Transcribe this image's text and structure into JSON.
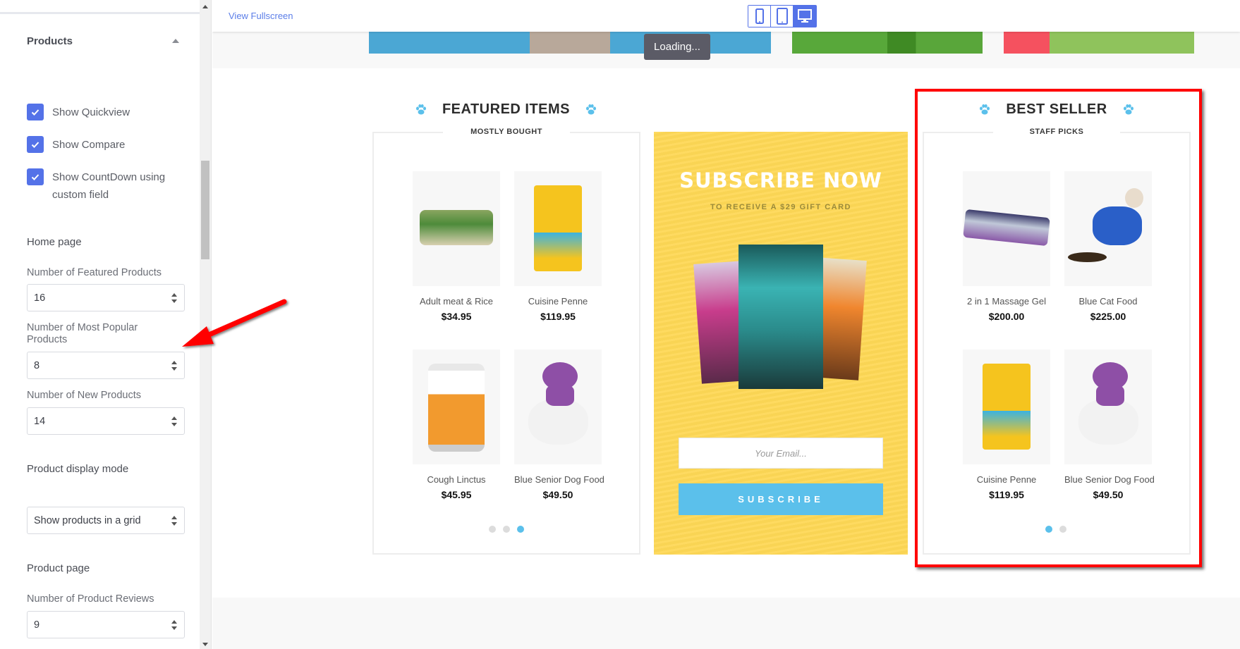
{
  "sidebar": {
    "section_title": "Products",
    "checkboxes": [
      {
        "label": "Show Quickview",
        "checked": true
      },
      {
        "label": "Show Compare",
        "checked": true
      },
      {
        "label": "Show CountDown using custom field",
        "checked": true
      }
    ],
    "home_heading": "Home page",
    "fields": {
      "featured": {
        "label": "Number of Featured Products",
        "value": "16"
      },
      "popular": {
        "label": "Number of Most Popular Products",
        "value": "8"
      },
      "new": {
        "label": "Number of New Products",
        "value": "14"
      }
    },
    "display_mode": {
      "label": "Product display mode",
      "value": "Show products in a grid"
    },
    "product_page_heading": "Product page",
    "reviews": {
      "label": "Number of Product Reviews",
      "value": "9"
    }
  },
  "preview": {
    "view_fullscreen": "View Fullscreen",
    "devices": [
      {
        "name": "mobile",
        "active": false
      },
      {
        "name": "tablet",
        "active": false
      },
      {
        "name": "desktop",
        "active": true
      }
    ],
    "loading": "Loading...",
    "featured": {
      "title": "FEATURED ITEMS",
      "subtitle": "MOSTLY BOUGHT",
      "products": [
        {
          "name": "Adult meat & Rice",
          "price": "$34.95"
        },
        {
          "name": "Cuisine Penne",
          "price": "$119.95"
        },
        {
          "name": "Cough Linctus",
          "price": "$45.95"
        },
        {
          "name": "Blue Senior Dog Food",
          "price": "$49.50"
        }
      ],
      "pages": 3,
      "active_page": 3
    },
    "subscribe": {
      "title": "SUBSCRIBE NOW",
      "caption": "TO RECEIVE A $29 GIFT CARD",
      "email_placeholder": "Your Email...",
      "button": "SUBSCRIBE"
    },
    "bestseller": {
      "title": "BEST SELLER",
      "subtitle": "STAFF PICKS",
      "products": [
        {
          "name": "2 in 1 Massage Gel",
          "price": "$200.00"
        },
        {
          "name": "Blue Cat Food",
          "price": "$225.00"
        },
        {
          "name": "Cuisine Penne",
          "price": "$119.95"
        },
        {
          "name": "Blue Senior Dog Food",
          "price": "$49.50"
        }
      ],
      "pages": 2,
      "active_page": 1
    }
  },
  "colors": {
    "accent": "#5472e8",
    "paw": "#5bc0eb",
    "subscribe_bg": "#fed856",
    "annotation_red": "#ff0000"
  }
}
